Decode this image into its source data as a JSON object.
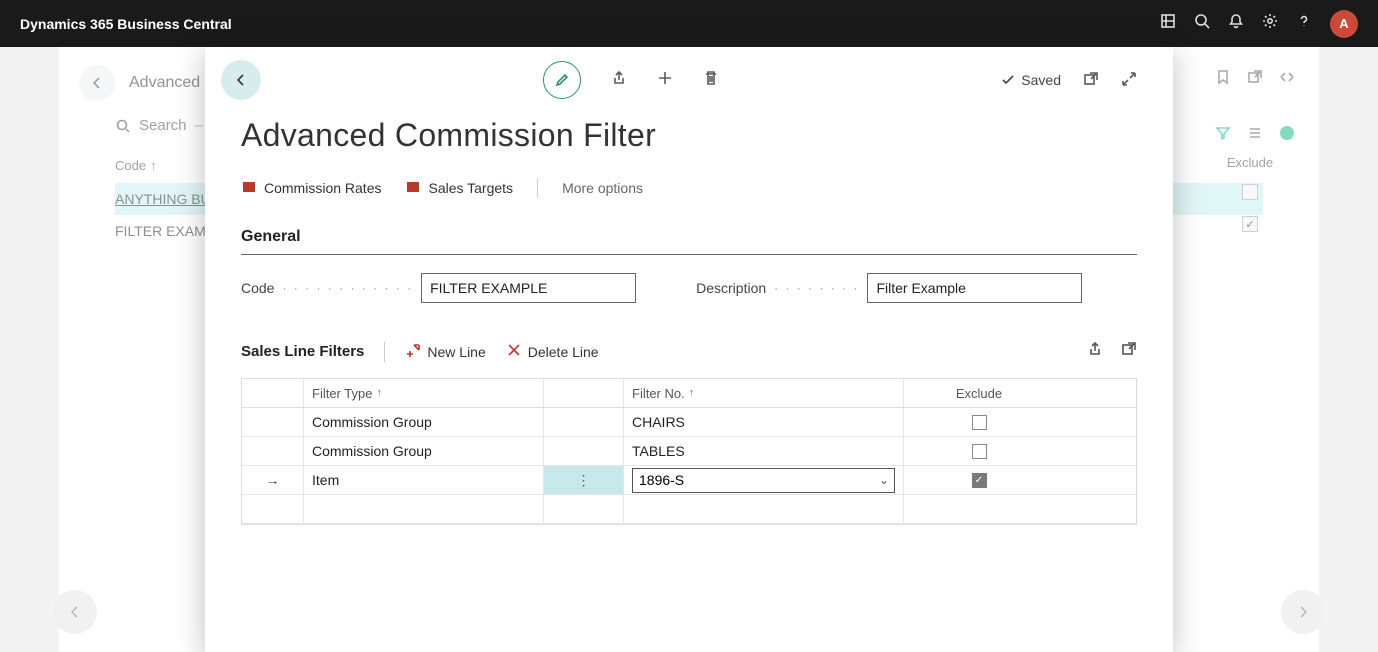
{
  "app": {
    "title": "Dynamics 365 Business Central",
    "avatar": "A"
  },
  "background": {
    "breadcrumb": "Advanced Com",
    "search_label": "Search",
    "col_code": "Code",
    "rows": [
      "ANYTHING BU",
      "FILTER EXAMP"
    ],
    "exclude_label": "Exclude"
  },
  "modal": {
    "title": "Advanced Commission Filter",
    "saved": "Saved",
    "actions": {
      "commission_rates": "Commission Rates",
      "sales_targets": "Sales Targets",
      "more": "More options"
    },
    "general": {
      "title": "General",
      "code_label": "Code",
      "code_value": "FILTER EXAMPLE",
      "desc_label": "Description",
      "desc_value": "Filter Example"
    },
    "filters": {
      "title": "Sales Line Filters",
      "new_line": "New Line",
      "delete_line": "Delete Line",
      "cols": {
        "filter_type": "Filter Type",
        "filter_no": "Filter No.",
        "exclude": "Exclude"
      },
      "rows": [
        {
          "type": "Commission Group",
          "no": "CHAIRS",
          "exclude": false,
          "active": false
        },
        {
          "type": "Commission Group",
          "no": "TABLES",
          "exclude": false,
          "active": false
        },
        {
          "type": "Item",
          "no": "1896-S",
          "exclude": true,
          "active": true
        }
      ]
    }
  }
}
